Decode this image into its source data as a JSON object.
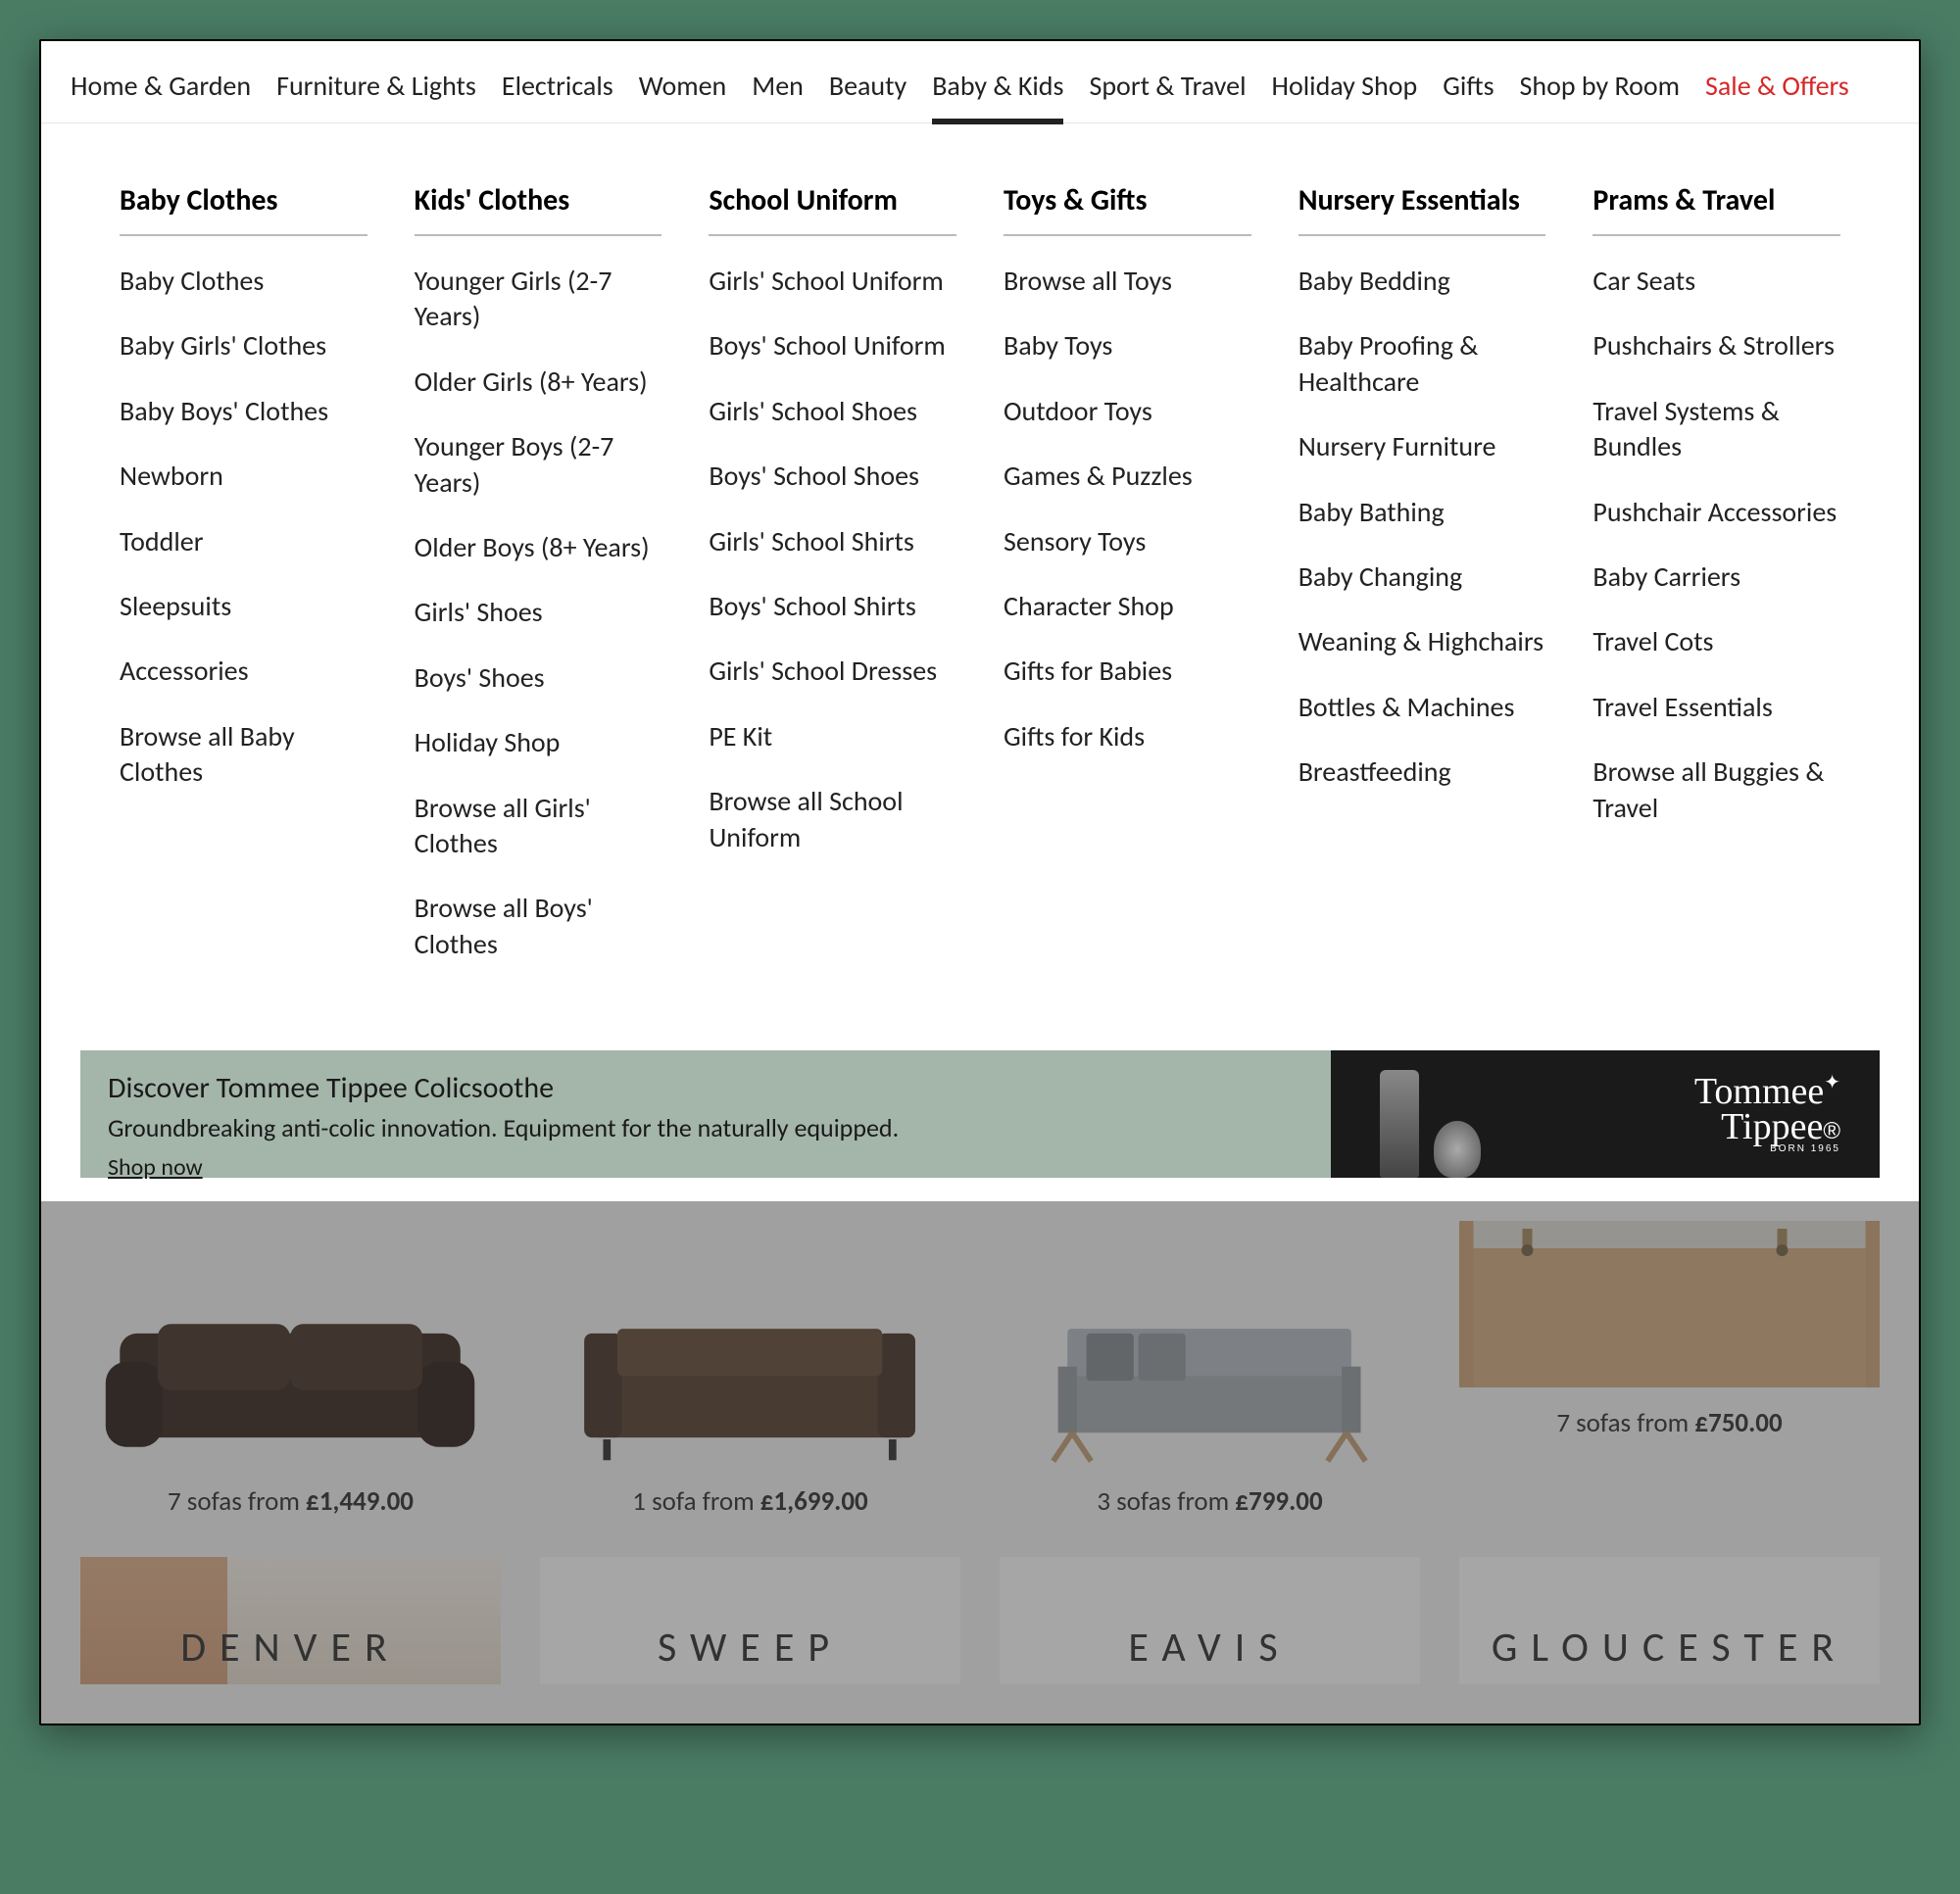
{
  "nav": [
    {
      "label": "Home & Garden"
    },
    {
      "label": "Furniture & Lights"
    },
    {
      "label": "Electricals"
    },
    {
      "label": "Women"
    },
    {
      "label": "Men"
    },
    {
      "label": "Beauty"
    },
    {
      "label": "Baby & Kids",
      "active": true
    },
    {
      "label": "Sport & Travel"
    },
    {
      "label": "Holiday Shop"
    },
    {
      "label": "Gifts"
    },
    {
      "label": "Shop by Room"
    },
    {
      "label": "Sale & Offers",
      "sale": true
    }
  ],
  "mega": [
    {
      "heading": "Baby Clothes",
      "items": [
        "Baby Clothes",
        "Baby Girls' Clothes",
        "Baby Boys' Clothes",
        "Newborn",
        "Toddler",
        "Sleepsuits",
        "Accessories",
        "Browse all Baby Clothes"
      ]
    },
    {
      "heading": "Kids' Clothes",
      "items": [
        "Younger Girls (2-7 Years)",
        "Older Girls (8+ Years)",
        "Younger Boys (2-7 Years)",
        "Older Boys (8+ Years)",
        "Girls' Shoes",
        "Boys' Shoes",
        "Holiday Shop",
        "Browse all Girls' Clothes",
        "Browse all Boys' Clothes"
      ]
    },
    {
      "heading": "School Uniform",
      "items": [
        "Girls' School Uniform",
        "Boys' School Uniform",
        "Girls' School Shoes",
        "Boys' School Shoes",
        "Girls' School Shirts",
        "Boys' School Shirts",
        "Girls' School Dresses",
        "PE Kit",
        "Browse all School Uniform"
      ]
    },
    {
      "heading": "Toys & Gifts",
      "items": [
        "Browse all Toys",
        "Baby Toys",
        "Outdoor Toys",
        "Games & Puzzles",
        "Sensory Toys",
        "Character Shop",
        "Gifts for Babies",
        "Gifts for Kids"
      ]
    },
    {
      "heading": "Nursery Essentials",
      "items": [
        "Baby Bedding",
        "Baby Proofing & Healthcare",
        "Nursery Furniture",
        "Baby Bathing",
        "Baby Changing",
        "Weaning & Highchairs",
        "Bottles & Machines",
        "Breastfeeding"
      ]
    },
    {
      "heading": "Prams & Travel",
      "items": [
        "Car Seats",
        "Pushchairs & Strollers",
        "Travel Systems & Bundles",
        "Pushchair Accessories",
        "Baby Carriers",
        "Travel Cots",
        "Travel Essentials",
        "Browse all Buggies & Travel"
      ]
    }
  ],
  "promo": {
    "title": "Discover Tommee Tippee Colicsoothe",
    "sub": "Groundbreaking anti-colic innovation. Equipment for the naturally equipped.",
    "link": "Shop now",
    "brand_line1": "Tommee",
    "brand_line2": "Tippee",
    "brand_tag": "BORN 1965"
  },
  "products": {
    "row1": [
      {
        "count": "7 sofas from ",
        "price": "£1,449.00"
      },
      {
        "count": "1 sofa from ",
        "price": "£1,699.00"
      },
      {
        "count": "3 sofas from ",
        "price": "£799.00"
      },
      {
        "count": "7 sofas from ",
        "price": "£750.00"
      }
    ],
    "row2": [
      "DENVER",
      "SWEEP",
      "EAVIS",
      "GLOUCESTER"
    ]
  }
}
